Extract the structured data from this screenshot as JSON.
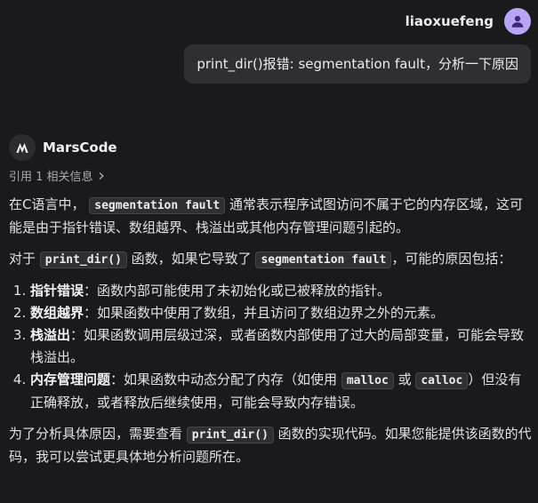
{
  "user": {
    "name": "liaoxuefeng",
    "avatar_icon": "user-avatar-icon"
  },
  "user_message": "print_dir()报错: segmentation fault，分析一下原因",
  "bot": {
    "name": "MarsCode",
    "refs_label": "引用 1 相关信息"
  },
  "answer": {
    "p1": {
      "a": "在C语言中，",
      "code": "segmentation fault",
      "b": "通常表示程序试图访问不属于它的内存区域，这可能是由于指针错误、数组越界、栈溢出或其他内存管理问题引起的。"
    },
    "p2": {
      "a": "对于",
      "code1": "print_dir()",
      "b": "函数，如果它导致了",
      "code2": "segmentation fault",
      "c": "，可能的原因包括："
    },
    "list": [
      {
        "term": "指针错误",
        "text": "：函数内部可能使用了未初始化或已被释放的指针。"
      },
      {
        "term": "数组越界",
        "text": "：如果函数中使用了数组，并且访问了数组边界之外的元素。"
      },
      {
        "term": "栈溢出",
        "text": "：如果函数调用层级过深，或者函数内部使用了过大的局部变量，可能会导致栈溢出。"
      },
      {
        "term": "内存管理问题",
        "text_a": "：如果函数中动态分配了内存（如使用",
        "code1": "malloc",
        "or": "或",
        "code2": "calloc",
        "text_b": "）但没有正确释放，或者释放后继续使用，可能会导致内存错误。"
      }
    ],
    "p3": {
      "a": "为了分析具体原因，需要查看",
      "code": "print_dir()",
      "b": "函数的实现代码。如果您能提供该函数的代码，我可以尝试更具体地分析问题所在。"
    }
  }
}
